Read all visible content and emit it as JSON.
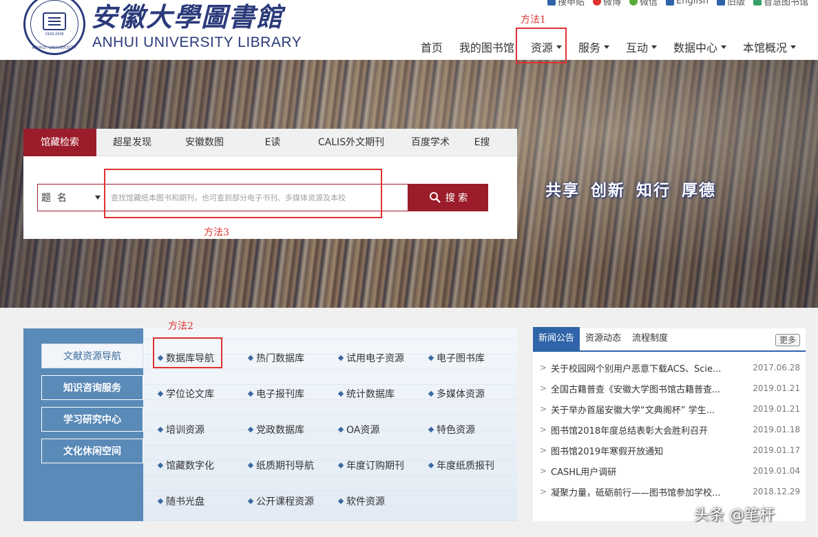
{
  "header": {
    "logo_cn": "安徽大學圖書館",
    "logo_en": "ANHUI UNIVERSITY LIBRARY",
    "seal_year": "1928-2008",
    "seal_ring": "ANHUI UNIVERSITY",
    "toplinks": [
      {
        "label": "搜申贴",
        "icon": "share-icon",
        "color": "#2f64a8"
      },
      {
        "label": "微博",
        "icon": "weibo-icon",
        "color": "#e03030"
      },
      {
        "label": "微信",
        "icon": "wechat-icon",
        "color": "#5aaa3a"
      },
      {
        "label": "English",
        "icon": "english-icon",
        "color": "#2f64a8"
      },
      {
        "label": "旧版",
        "icon": "old-version-icon",
        "color": "#2f64a8"
      },
      {
        "label": "智慧图书馆",
        "icon": "smart-library-icon",
        "color": "#3aa06a"
      }
    ],
    "nav": [
      {
        "label": "首页",
        "has_dropdown": false
      },
      {
        "label": "我的图书馆",
        "has_dropdown": false
      },
      {
        "label": "资源",
        "has_dropdown": true
      },
      {
        "label": "服务",
        "has_dropdown": true
      },
      {
        "label": "互动",
        "has_dropdown": true
      },
      {
        "label": "数据中心",
        "has_dropdown": true
      },
      {
        "label": "本馆概况",
        "has_dropdown": true
      }
    ]
  },
  "annotations": {
    "method1": "方法1",
    "method2": "方法2",
    "method3": "方法3",
    "color": "#e03030"
  },
  "banner": {
    "slogan": "共享 创新 知行 厚德"
  },
  "search": {
    "tabs": [
      "馆藏检索",
      "超星发现",
      "安徽数图",
      "E读",
      "CALIS外文期刊",
      "百度学术",
      "E搜"
    ],
    "active_tab": "馆藏检索",
    "field_select": "题  名",
    "placeholder": "查找馆藏纸本图书和期刊，也可查到部分电子书刊、多媒体资源及本校",
    "button_label": "搜 索",
    "accent": "#9b1c2a"
  },
  "resources": {
    "side": [
      {
        "label": "文献资源导航",
        "active": true
      },
      {
        "label": "知识咨询服务",
        "active": false
      },
      {
        "label": "学习研究中心",
        "active": false
      },
      {
        "label": "文化休闲空间",
        "active": false
      }
    ],
    "items": [
      [
        "数据库导航",
        "热门数据库",
        "试用电子资源",
        "电子图书库"
      ],
      [
        "学位论文库",
        "电子报刊库",
        "统计数据库",
        "多媒体资源"
      ],
      [
        "培训资源",
        "党政数据库",
        "OA资源",
        "特色资源"
      ],
      [
        "馆藏数字化",
        "纸质期刊导航",
        "年度订购期刊",
        "年度纸质报刊"
      ],
      [
        "随书光盘",
        "公开课程资源",
        "软件资源"
      ]
    ]
  },
  "news": {
    "tabs": [
      "新闻公告",
      "资源动态",
      "流程制度"
    ],
    "more": "更多",
    "accent": "#2f64a8",
    "items": [
      {
        "title": "关于校园网个别用户恶意下载ACS、Scie...",
        "date": "2017.06.28"
      },
      {
        "title": "全国古籍普查《安徽大学图书馆古籍普查...",
        "date": "2019.01.21"
      },
      {
        "title": "关于举办首届安徽大学“文典阁杯” 学生...",
        "date": "2019.01.21"
      },
      {
        "title": "图书馆2018年度总结表彰大会胜利召开",
        "date": "2019.01.18"
      },
      {
        "title": "图书馆2019年寒假开放通知",
        "date": "2019.01.17"
      },
      {
        "title": "CASHL用户调研",
        "date": "2019.01.04"
      },
      {
        "title": "凝聚力量，砥砺前行——图书馆参加学校...",
        "date": "2018.12.29"
      }
    ]
  },
  "watermark": "头条 @笔杆"
}
